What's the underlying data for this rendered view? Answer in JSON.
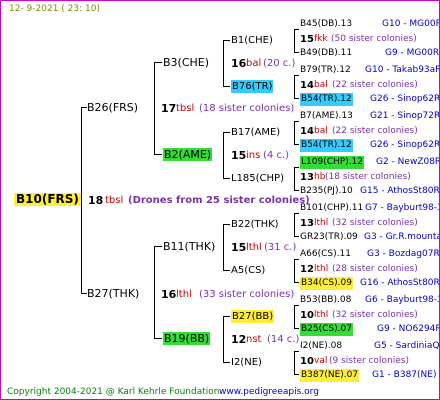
{
  "header": {
    "date": "12-  9-2021 ( 23: 10)"
  },
  "footer": {
    "copyright": "Copyright 2004-2021 @ Karl Kehrle Foundation",
    "site": "www.pedigreeapis.org"
  },
  "root": {
    "label": "B10(FRS)",
    "count": "18",
    "tag": "tbsl",
    "note": "(Drones from 25 sister colonies)",
    "highlight": "#ffee33"
  },
  "gen1": [
    {
      "id": "B26(FRS)",
      "count": "17",
      "tag": "tbsl",
      "note": "(18 sister colonies)"
    },
    {
      "id": "B27(THK)",
      "count": "16",
      "tag": "lthl",
      "note": "(33 sister colonies)"
    }
  ],
  "gen2": [
    {
      "id": "B3(CHE)",
      "count": "16",
      "tag": "bal",
      "note": "(20 c.)"
    },
    {
      "id": "B2(AME)",
      "count": "15",
      "tag": "ins",
      "note": "(4 c.)"
    },
    {
      "id": "B11(THK)",
      "count": "15",
      "tag": "lthl",
      "note": "(31 c.)"
    },
    {
      "id": "B19(BB)",
      "count": "12",
      "tag": "nst",
      "note": "(14 c.)"
    }
  ],
  "gen3": [
    {
      "id": "B1(CHE)"
    },
    {
      "id": "B76(TR)"
    },
    {
      "id": "B17(AME)"
    },
    {
      "id": "L185(CHP)"
    },
    {
      "id": "B22(THK)"
    },
    {
      "id": "A5(CS)"
    },
    {
      "id": "B27(BB)"
    },
    {
      "id": "I2(NE)"
    }
  ],
  "gen4": [
    {
      "left": "B45(DB).13",
      "right": "G10 - MG00R",
      "count": "15",
      "tag": "fkk",
      "note": "(50 sister colonies)"
    },
    {
      "left": "B49(DB).11",
      "right": "G9 - MG00R"
    },
    {
      "left": "B79(TR).12",
      "right": "G10 - Takab93aR",
      "count": "14",
      "tag": "bal",
      "note": "(22 sister colonies)"
    },
    {
      "left": "B54(TR).12",
      "right": "G26 - Sinop62R"
    },
    {
      "left": "B7(AME).13",
      "right": "G21 - Sinop72R",
      "count": "14",
      "tag": "bal",
      "note": "(22 sister colonies)"
    },
    {
      "left": "B54(TR).12",
      "right": "G26 - Sinop62R"
    },
    {
      "left": "L109(CHP).12",
      "right": "G2 - NewZ08R",
      "count": "13",
      "tag": "hb",
      "note": "(18 sister colonies)"
    },
    {
      "left": "B235(PJ).10",
      "right": "G15 - AthosSt80R"
    },
    {
      "left": "B101(CHP).11",
      "right": "G7 - Bayburt98-3",
      "count": "13",
      "tag": "lthl",
      "note": "(32 sister colonies)"
    },
    {
      "left": "GR23(TR).09",
      "right": "G3 - Gr.R.mounta"
    },
    {
      "left": "A66(CS).11",
      "right": "G3 - Bozdag07R",
      "count": "12",
      "tag": "lthl",
      "note": "(28 sister colonies)"
    },
    {
      "left": "B34(CS).09",
      "right": "G16 - AthosSt80R"
    },
    {
      "left": "B53(BB).08",
      "right": "G6 - Bayburt98-3",
      "count": "10",
      "tag": "lthl",
      "note": "(32 sister colonies)"
    },
    {
      "left": "B25(CS).07",
      "right": "G9 - NO6294R"
    },
    {
      "left": "I2(NE).08",
      "right": "G5 - SardiniaQ",
      "count": "10",
      "tag": "val",
      "note": "(9 sister colonies)"
    },
    {
      "left": "B387(NE).07",
      "right": "G1 - B387(NE)"
    }
  ],
  "colors": {
    "border": "#cc00cc",
    "olive": "#888800",
    "blue": "#0000cc",
    "purple": "#7733aa",
    "red": "#cc0000",
    "cyan_highlight": "#33ccff",
    "green_highlight": "#33dd33",
    "yellow_highlight": "#ffee33"
  }
}
